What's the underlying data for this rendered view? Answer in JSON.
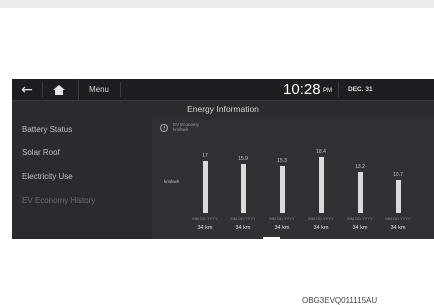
{
  "topbar": {
    "menu_label": "Menu",
    "time": "10:28",
    "ampm": "PM",
    "date": "DEC. 31"
  },
  "title": "Energy Information",
  "sidebar": {
    "items": [
      {
        "label": "Battery Status"
      },
      {
        "label": "Solar Roof"
      },
      {
        "label": "Electricity Use"
      },
      {
        "label": "EV Economy History"
      }
    ]
  },
  "legend": {
    "line1": "EV Economy",
    "line2": "km/kwh"
  },
  "y_unit": "km/kwh",
  "chart_data": {
    "type": "bar",
    "ylabel": "km/kwh",
    "categories": [
      "MM.DD.YYYY",
      "MM.DD.YYYY",
      "MM.DD.YYYY",
      "MM.DD.YYYY",
      "MM.DD.YYYY",
      "MM.DD.YYYY"
    ],
    "values": [
      17,
      15.9,
      15.3,
      18.4,
      13.2,
      10.7
    ],
    "distances": [
      "34 km",
      "34 km",
      "34 km",
      "34 km",
      "34 km",
      "34 km"
    ],
    "ylim": [
      0,
      20
    ]
  },
  "caption": "OBG3EVQ011115AU",
  "colors": {
    "screen": "#2a2b2e",
    "bar": "#d9dadc"
  }
}
